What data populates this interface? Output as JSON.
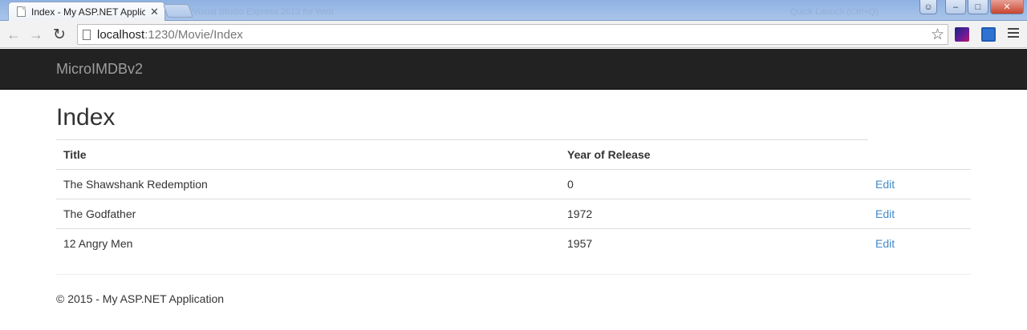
{
  "browser": {
    "tab_title": "Index - My ASP.NET Application",
    "tab_close": "✕",
    "ghost_text_1": "Visual Studio Express 2013 for Web",
    "ghost_text_2": "Quick Launch (Ctrl+Q)",
    "url_host": "localhost",
    "url_path": ":1230/Movie/Index",
    "back_icon": "arrow-left-icon",
    "forward_icon": "arrow-right-icon",
    "reload_icon": "reload-icon",
    "star_icon": "star-icon"
  },
  "navbar": {
    "brand": "MicroIMDBv2"
  },
  "page": {
    "title": "Index"
  },
  "table": {
    "headers": [
      "Title",
      "Year of Release"
    ],
    "rows": [
      {
        "title": "The Shawshank Redemption",
        "year": "0",
        "action": "Edit"
      },
      {
        "title": "The Godfather",
        "year": "1972",
        "action": "Edit"
      },
      {
        "title": "12 Angry Men",
        "year": "1957",
        "action": "Edit"
      }
    ]
  },
  "footer": {
    "text": "© 2015 - My ASP.NET Application"
  },
  "colors": {
    "navbar_bg": "#222222",
    "link": "#428bca",
    "brand": "#9d9d9d"
  }
}
